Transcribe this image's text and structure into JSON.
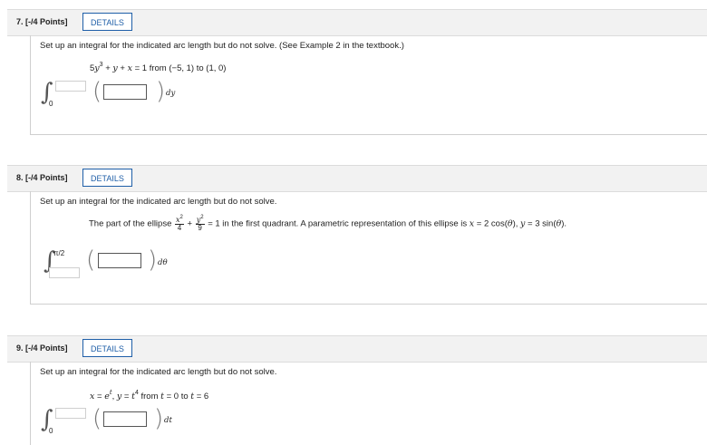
{
  "questions": [
    {
      "title": "7. [-/4 Points]",
      "details_label": "DETAILS",
      "prompt": "Set up an integral for the indicated arc length but do not solve. (See Example 2 in the textbook.)",
      "equation_text": "5y³ + y + x = 1 from (−5, 1) to (1, 0)",
      "lower_limit": "0",
      "differential": "dy"
    },
    {
      "title": "8. [-/4 Points]",
      "details_label": "DETAILS",
      "prompt": "Set up an integral for the indicated arc length but do not solve.",
      "equation_text": "The part of the ellipse x²/4 + y²/9 = 1 in the first quadrant. A parametric representation of this ellipse is x = 2 cos(θ), y = 3 sin(θ).",
      "upper_limit": "π/2",
      "differential": "dθ"
    },
    {
      "title": "9. [-/4 Points]",
      "details_label": "DETAILS",
      "prompt": "Set up an integral for the indicated arc length but do not solve.",
      "equation_text": "x = eᵗ, y = t⁴ from t = 0 to t = 6",
      "lower_limit": "0",
      "differential": "dt"
    }
  ]
}
